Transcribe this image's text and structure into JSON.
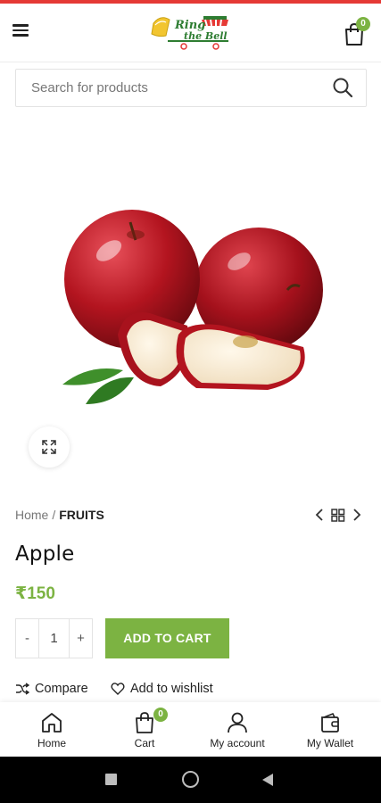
{
  "header": {
    "logo_text_line1": "Ring",
    "logo_text_line2": "the Bell",
    "cart_count": "0"
  },
  "search": {
    "placeholder": "Search for products"
  },
  "breadcrumb": {
    "home": "Home",
    "separator": "/",
    "current": "FRUITS"
  },
  "product": {
    "title": "Apple",
    "price": "₹150",
    "quantity": "1",
    "minus_label": "-",
    "plus_label": "+",
    "add_to_cart_label": "ADD TO CART"
  },
  "actions": {
    "compare_label": "Compare",
    "wishlist_label": "Add to wishlist"
  },
  "bottom_nav": {
    "items": [
      {
        "label": "Home",
        "icon": "home-icon"
      },
      {
        "label": "Cart",
        "icon": "cart-icon",
        "badge": "0"
      },
      {
        "label": "My account",
        "icon": "user-icon"
      },
      {
        "label": "My Wallet",
        "icon": "wallet-icon"
      }
    ]
  },
  "colors": {
    "accent": "#7cb342",
    "top_stripe": "#e53935"
  }
}
